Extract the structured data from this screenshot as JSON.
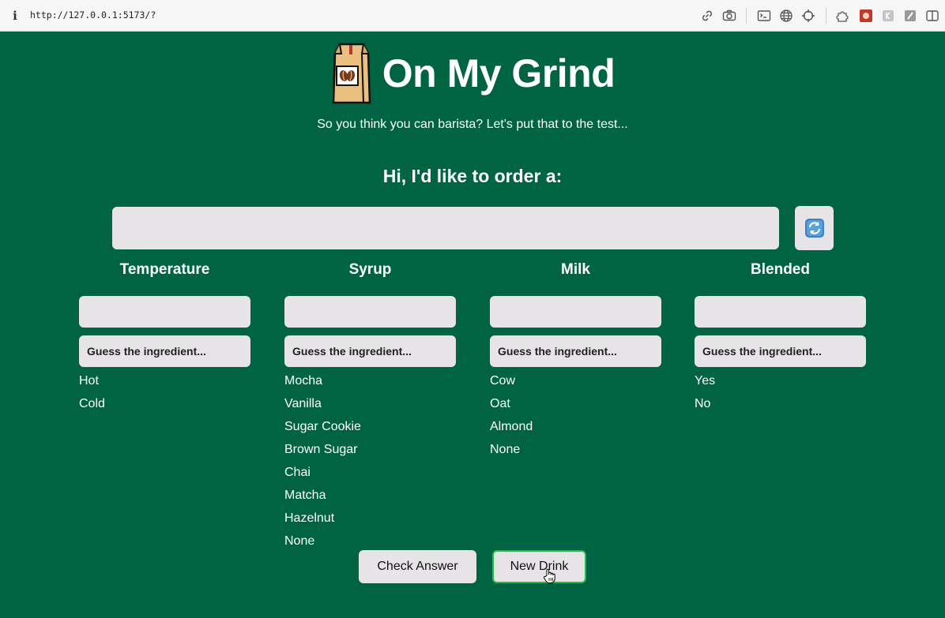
{
  "browser": {
    "info_icon_glyph": "i",
    "url": "http://127.0.0.1:5173/?",
    "icons": [
      "link-icon",
      "camera-icon",
      "terminal-icon",
      "globe-icon",
      "crosshair-icon",
      "extensions-icon",
      "red-extension-icon",
      "grey-extension-icon",
      "green-extension-icon",
      "sidebar-icon"
    ]
  },
  "app": {
    "title": "On My Grind",
    "subtitle": "So you think you can barista? Let's put that to the test...",
    "order_heading": "Hi, I'd like to order a:",
    "order_value": ""
  },
  "columns": [
    {
      "heading": "Temperature",
      "placeholder": "Guess the ingredient...",
      "options": [
        "Hot",
        "Cold"
      ]
    },
    {
      "heading": "Syrup",
      "placeholder": "Guess the ingredient...",
      "options": [
        "Mocha",
        "Vanilla",
        "Sugar Cookie",
        "Brown Sugar",
        "Chai",
        "Matcha",
        "Hazelnut",
        "None"
      ]
    },
    {
      "heading": "Milk",
      "placeholder": "Guess the ingredient...",
      "options": [
        "Cow",
        "Oat",
        "Almond",
        "None"
      ]
    },
    {
      "heading": "Blended",
      "placeholder": "Guess the ingredient...",
      "options": [
        "Yes",
        "No"
      ]
    }
  ],
  "buttons": {
    "check": "Check Answer",
    "new_drink": "New Drink"
  },
  "colors": {
    "background": "#006341",
    "field": "#e6e4e6",
    "focus_border": "#2fb84a"
  }
}
